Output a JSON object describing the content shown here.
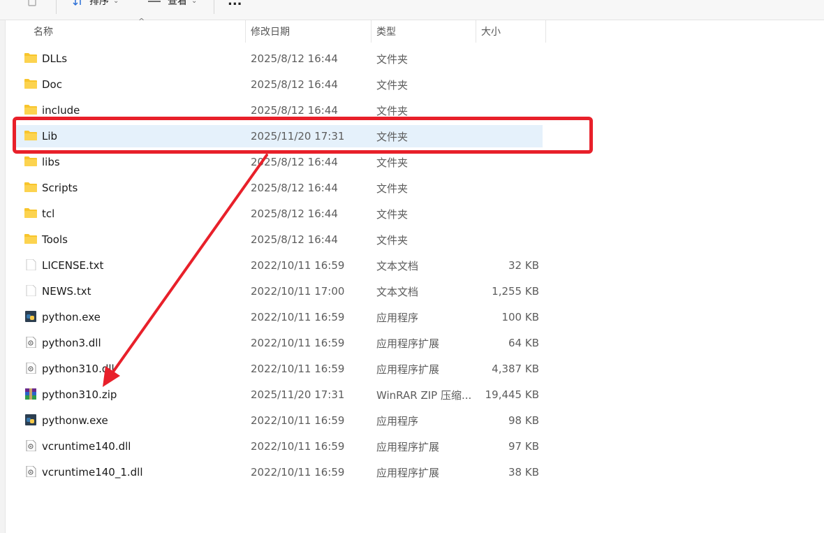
{
  "toolbar": {
    "sort_label": "排序",
    "view_label": "查看",
    "more_label": "..."
  },
  "columns": {
    "name": "名称",
    "date": "修改日期",
    "type": "类型",
    "size": "大小"
  },
  "files": [
    {
      "name": "DLLs",
      "date": "2025/8/12 16:44",
      "type": "文件夹",
      "size": "",
      "icon": "folder-icon"
    },
    {
      "name": "Doc",
      "date": "2025/8/12 16:44",
      "type": "文件夹",
      "size": "",
      "icon": "folder-icon"
    },
    {
      "name": "include",
      "date": "2025/8/12 16:44",
      "type": "文件夹",
      "size": "",
      "icon": "folder-icon"
    },
    {
      "name": "Lib",
      "date": "2025/11/20 17:31",
      "type": "文件夹",
      "size": "",
      "icon": "folder-icon",
      "selected": true
    },
    {
      "name": "libs",
      "date": "2025/8/12 16:44",
      "type": "文件夹",
      "size": "",
      "icon": "folder-icon"
    },
    {
      "name": "Scripts",
      "date": "2025/8/12 16:44",
      "type": "文件夹",
      "size": "",
      "icon": "folder-icon"
    },
    {
      "name": "tcl",
      "date": "2025/8/12 16:44",
      "type": "文件夹",
      "size": "",
      "icon": "folder-icon"
    },
    {
      "name": "Tools",
      "date": "2025/8/12 16:44",
      "type": "文件夹",
      "size": "",
      "icon": "folder-icon"
    },
    {
      "name": "LICENSE.txt",
      "date": "2022/10/11 16:59",
      "type": "文本文档",
      "size": "32 KB",
      "icon": "text-file-icon"
    },
    {
      "name": "NEWS.txt",
      "date": "2022/10/11 17:00",
      "type": "文本文档",
      "size": "1,255 KB",
      "icon": "text-file-icon"
    },
    {
      "name": "python.exe",
      "date": "2022/10/11 16:59",
      "type": "应用程序",
      "size": "100 KB",
      "icon": "python-exe-icon"
    },
    {
      "name": "python3.dll",
      "date": "2022/10/11 16:59",
      "type": "应用程序扩展",
      "size": "64 KB",
      "icon": "dll-file-icon"
    },
    {
      "name": "python310.dll",
      "date": "2022/10/11 16:59",
      "type": "应用程序扩展",
      "size": "4,387 KB",
      "icon": "dll-file-icon"
    },
    {
      "name": "python310.zip",
      "date": "2025/11/20 17:31",
      "type": "WinRAR ZIP 压缩...",
      "size": "19,445 KB",
      "icon": "winrar-zip-icon"
    },
    {
      "name": "pythonw.exe",
      "date": "2022/10/11 16:59",
      "type": "应用程序",
      "size": "98 KB",
      "icon": "python-exe-icon"
    },
    {
      "name": "vcruntime140.dll",
      "date": "2022/10/11 16:59",
      "type": "应用程序扩展",
      "size": "97 KB",
      "icon": "dll-file-icon"
    },
    {
      "name": "vcruntime140_1.dll",
      "date": "2022/10/11 16:59",
      "type": "应用程序扩展",
      "size": "38 KB",
      "icon": "dll-file-icon"
    }
  ],
  "colors": {
    "annotation_red": "#e8202a",
    "selection_blue": "#e5f1fb",
    "folder_yellow": "#f8c52c"
  }
}
